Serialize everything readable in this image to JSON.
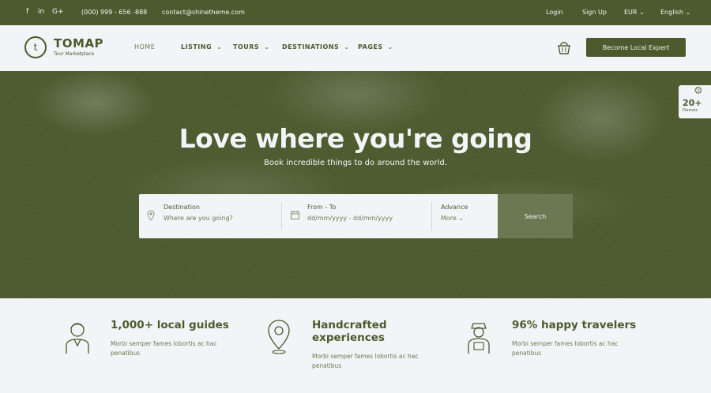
{
  "topbar": {
    "social": [
      "f",
      "in",
      "G+"
    ],
    "phone": "(000) 999 - 656 -888",
    "email": "contact@shinetheme.com",
    "login": "Login",
    "signup": "Sign Up",
    "currency": "EUR",
    "language": "English"
  },
  "brand": {
    "mark": "t",
    "name": "TOMAP",
    "tagline": "Tour Marketplace"
  },
  "nav": {
    "items": [
      "HOME",
      "LISTING",
      "TOURS",
      "DESTINATIONS",
      "PAGES"
    ],
    "cta": "Become Local Expert"
  },
  "hero": {
    "title": "Love where you're going",
    "subtitle": "Book incredible things to do around the world.",
    "demos": {
      "count": "20+",
      "label": "Demos"
    }
  },
  "search": {
    "destination_label": "Destination",
    "destination_placeholder": "Where are you going?",
    "dates_label": "From - To",
    "dates_value": "dd/mm/yyyy - dd/mm/yyyy",
    "advance_label": "Advance",
    "advance_value": "More",
    "button": "Search"
  },
  "features": [
    {
      "title": "1,000+ local guides",
      "desc": "Morbi semper fames lobortis ac hac penatibus",
      "icon": "guide-icon"
    },
    {
      "title": "Handcrafted experiences",
      "desc": "Morbi semper fames lobortis ac hac penatibus",
      "icon": "location-pin-icon"
    },
    {
      "title": "96% happy travelers",
      "desc": "Morbi semper fames lobortis ac hac penatibus",
      "icon": "traveler-icon"
    }
  ],
  "colors": {
    "primary": "#4c5a2e",
    "background": "#f1f5f7",
    "muted": "#6b7852"
  }
}
